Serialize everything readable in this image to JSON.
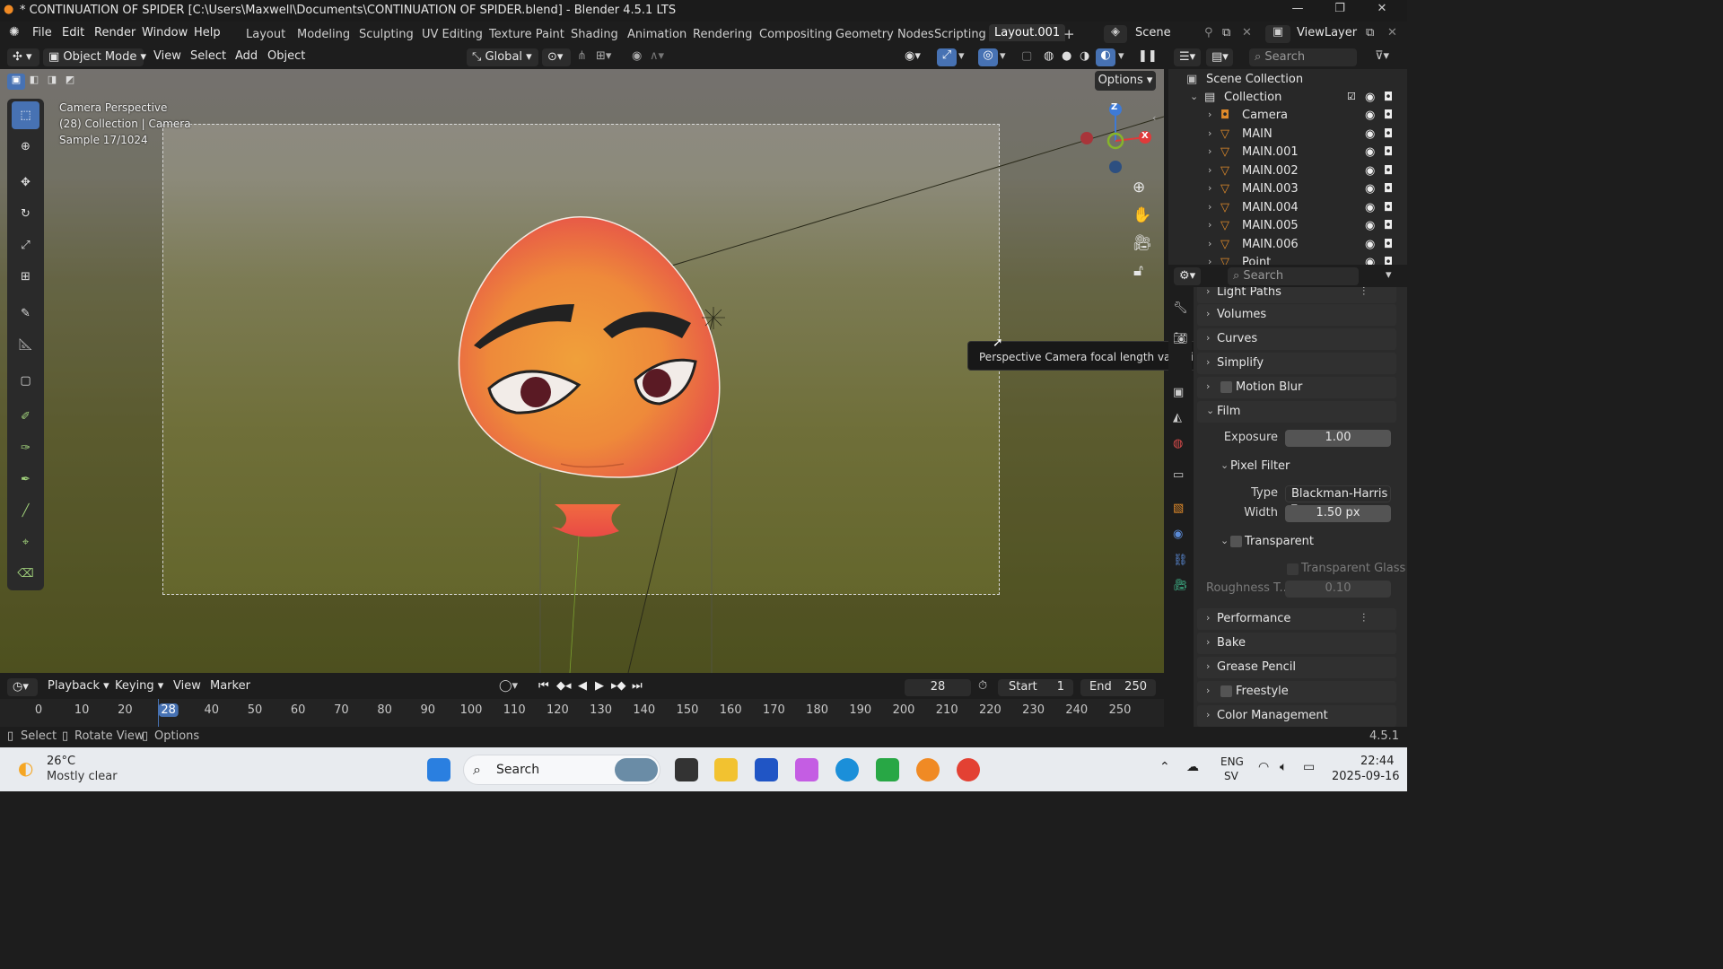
{
  "window": {
    "title": "* CONTINUATION OF SPIDER [C:\\Users\\Maxwell\\Documents\\CONTINUATION OF SPIDER.blend] - Blender 4.5.1 LTS"
  },
  "menubar": {
    "items": [
      "File",
      "Edit",
      "Render",
      "Window",
      "Help"
    ]
  },
  "workspaces": [
    "Layout",
    "Modeling",
    "Sculpting",
    "UV Editing",
    "Texture Paint",
    "Shading",
    "Animation",
    "Rendering",
    "Compositing",
    "Geometry Nodes",
    "Scripting",
    "Layout.001"
  ],
  "scene": {
    "name": "Scene",
    "view_layer": "ViewLayer"
  },
  "viewport_header": {
    "mode": "Object Mode",
    "menus": [
      "View",
      "Select",
      "Add",
      "Object"
    ],
    "orientation": "Global",
    "options_label": "Options"
  },
  "viewport_overlay": {
    "line1": "Camera Perspective",
    "line2": "(28) Collection | Camera",
    "line3": "Sample 17/1024"
  },
  "gizmo": {
    "z": "Z",
    "x": "X"
  },
  "tooltip": "Perspective Camera focal length value in millimeters",
  "outliner": {
    "search_placeholder": "Search",
    "scene_collection": "Scene Collection",
    "collection": "Collection",
    "items": [
      "Camera",
      "MAIN",
      "MAIN.001",
      "MAIN.002",
      "MAIN.003",
      "MAIN.004",
      "MAIN.005",
      "MAIN.006",
      "Point"
    ]
  },
  "properties": {
    "search_placeholder": "Search",
    "panels_top": [
      "Light Paths",
      "Volumes",
      "Curves",
      "Simplify",
      "Motion Blur"
    ],
    "film": {
      "label": "Film",
      "exposure_label": "Exposure",
      "exposure": "1.00",
      "pixel_filter_label": "Pixel Filter",
      "type_label": "Type",
      "type": "Blackman-Harris",
      "width_label": "Width",
      "width": "1.50 px",
      "transparent_label": "Transparent",
      "transparent_glass_label": "Transparent Glass",
      "roughness_label": "Roughness T...",
      "roughness": "0.10"
    },
    "panels_bottom": [
      "Performance",
      "Bake",
      "Grease Pencil",
      "Freestyle",
      "Color Management"
    ]
  },
  "timeline": {
    "menus": [
      "Playback",
      "Keying",
      "View",
      "Marker"
    ],
    "current_frame": "28",
    "start_label": "Start",
    "start": "1",
    "end_label": "End",
    "end": "250",
    "ticks": [
      "0",
      "10",
      "20",
      "28",
      "40",
      "50",
      "60",
      "70",
      "80",
      "90",
      "100",
      "110",
      "120",
      "130",
      "140",
      "150",
      "160",
      "170",
      "180",
      "190",
      "200",
      "210",
      "220",
      "230",
      "240",
      "250"
    ]
  },
  "statusbar": {
    "select": "Select",
    "rotate": "Rotate View",
    "options": "Options",
    "version": "4.5.1"
  },
  "taskbar": {
    "weather_temp": "26°C",
    "weather_desc": "Mostly clear",
    "search_label": "Search",
    "lang1": "ENG",
    "lang2": "SV",
    "time": "22:44",
    "date": "2025-09-16"
  },
  "colors": {
    "accent": "#4772b3",
    "axis_x": "#e03a3a",
    "axis_y": "#86b52a",
    "axis_z": "#3e7ad6"
  }
}
